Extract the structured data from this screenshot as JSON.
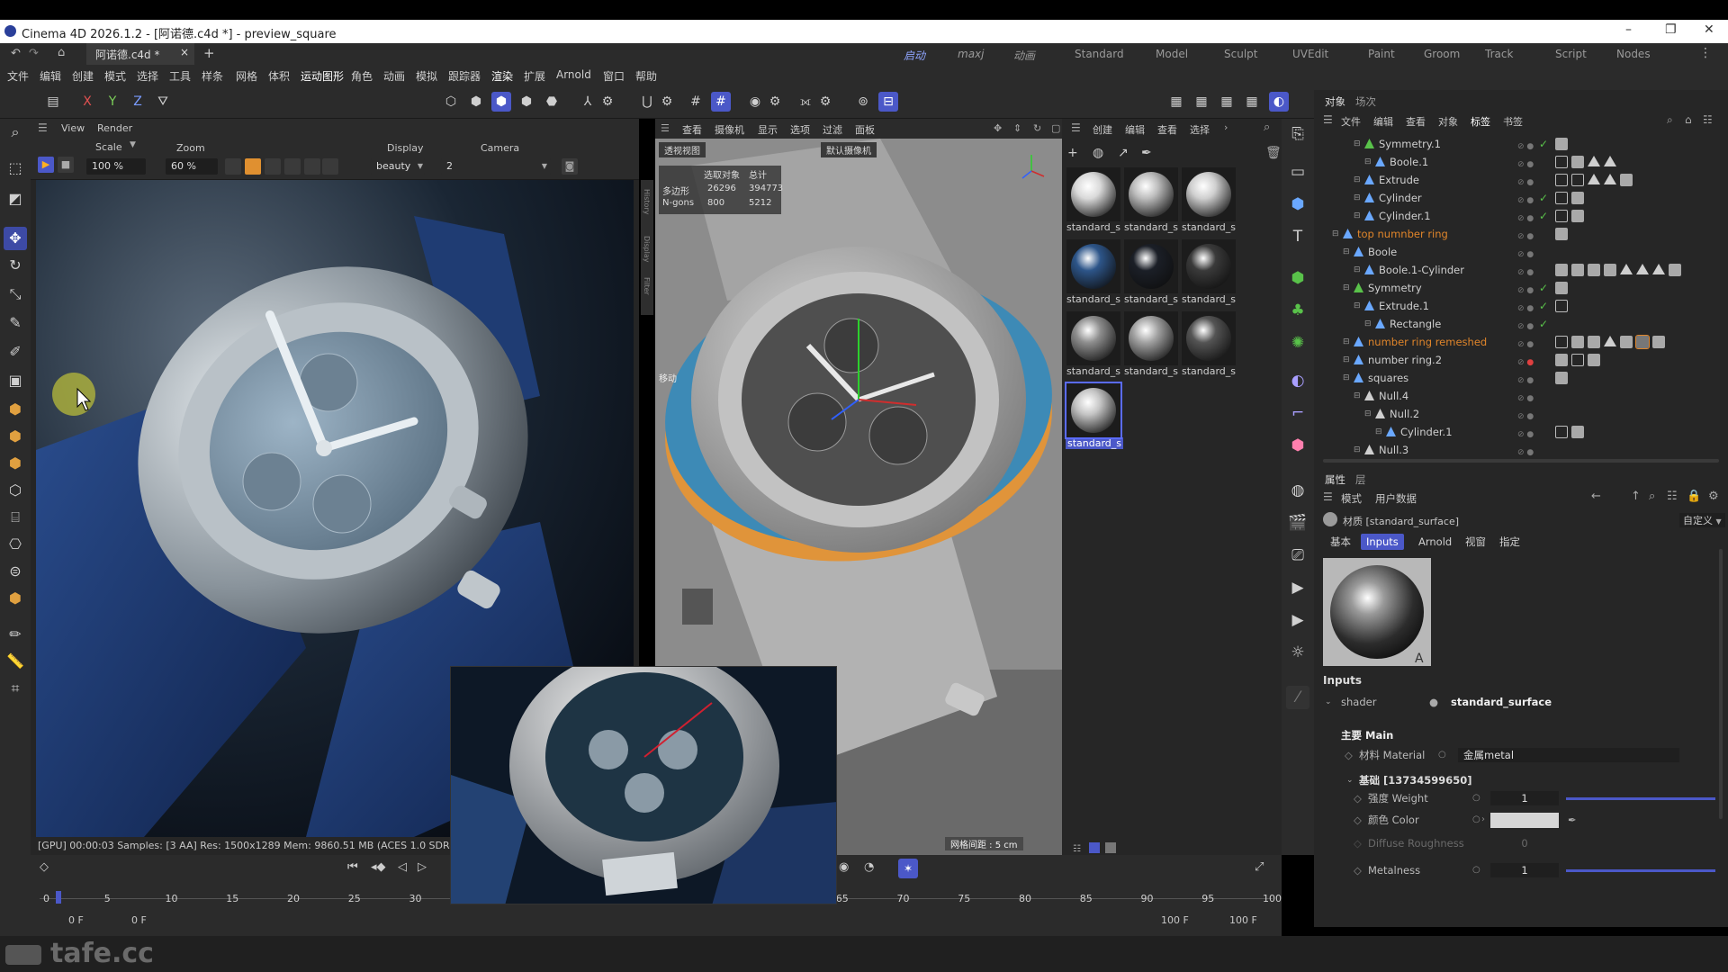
{
  "window": {
    "title": "Cinema 4D 2026.1.2 - [阿诺德.c4d *] - preview_square",
    "minimize": "–",
    "restore": "❐",
    "close": "✕"
  },
  "tabs": {
    "doc_tab": "阿诺德.c4d *",
    "close": "×",
    "add": "+",
    "layouts": [
      "启动",
      "maxj",
      "动画",
      "Standard",
      "Model",
      "Sculpt",
      "UVEdit",
      "Paint",
      "Groom",
      "Track",
      "Script",
      "Nodes"
    ],
    "more": "⋮"
  },
  "menu": [
    "文件",
    "编辑",
    "创建",
    "模式",
    "选择",
    "工具",
    "样条",
    "网格",
    "体积",
    "运动图形",
    "角色",
    "动画",
    "模拟",
    "跟踪器",
    "渲染",
    "扩展",
    "Arnold",
    "窗口",
    "帮助"
  ],
  "axes": {
    "x": "X",
    "y": "Y",
    "z": "Z"
  },
  "picture_viewer": {
    "menu": [
      "View",
      "Render"
    ],
    "scale_label": "Scale",
    "scale_value": "100 %",
    "zoom_label": "Zoom",
    "zoom_value": "60 %",
    "display_label": "Display",
    "display_value": "beauty",
    "camera_label": "Camera",
    "camera_value": "2",
    "status": "[GPU] 00:00:03  Samples: [3 AA]  Res: 1500x1289  Mem: 9860.51 MB  (ACES 1.0 SDR-vi",
    "side_labels": [
      "History",
      "Display",
      "Filter"
    ]
  },
  "viewport": {
    "menu": [
      "查看",
      "摄像机",
      "显示",
      "选项",
      "过滤",
      "面板"
    ],
    "view_name": "透视视图",
    "camera_name": "默认摄像机",
    "stats_header_sel": "选取对象",
    "stats_header_total": "总计",
    "polygons_label": "多边形",
    "polygons_sel": "26296",
    "polygons_total": "394773",
    "ngons_label": "N-gons",
    "ngons_sel": "800",
    "ngons_total": "5212",
    "move_label": "移动",
    "grid_spacing": "网格间距 : 5 cm"
  },
  "material_manager": {
    "menu": [
      "创建",
      "编辑",
      "查看",
      "选择"
    ],
    "materials": [
      {
        "label": "standard_s",
        "color": "#d9d9d9"
      },
      {
        "label": "standard_s",
        "color": "#bdbdbd"
      },
      {
        "label": "standard_s",
        "color": "#cfcfcf"
      },
      {
        "label": "standard_s",
        "color": "#2d5589"
      },
      {
        "label": "standard_s",
        "color": "#1b1f27"
      },
      {
        "label": "standard_s",
        "color": "#3a3a3a"
      },
      {
        "label": "standard_s",
        "color": "#8e8e8e"
      },
      {
        "label": "standard_s",
        "color": "#a2a2a2"
      },
      {
        "label": "standard_s",
        "color": "#545454"
      },
      {
        "label": "standard_s",
        "color": "#c4c4c4"
      }
    ]
  },
  "object_manager": {
    "tabs": [
      "对象",
      "场次"
    ],
    "menu": [
      "文件",
      "编辑",
      "查看",
      "对象",
      "标签",
      "书签"
    ],
    "rows": [
      {
        "name": "Symmetry.1",
        "indent": 3,
        "color": "#cfcfcf",
        "icon": "#59c24a"
      },
      {
        "name": "Boole.1",
        "indent": 4,
        "color": "#cfcfcf",
        "icon": "#6aa8ff"
      },
      {
        "name": "Extrude",
        "indent": 3,
        "color": "#cfcfcf",
        "icon": "#6aa8ff"
      },
      {
        "name": "Cylinder",
        "indent": 3,
        "color": "#cfcfcf",
        "icon": "#6aa8ff"
      },
      {
        "name": "Cylinder.1",
        "indent": 3,
        "color": "#cfcfcf",
        "icon": "#6aa8ff"
      },
      {
        "name": "top numnber ring",
        "indent": 1,
        "color": "#e0852a",
        "icon": "#6aa8ff"
      },
      {
        "name": "Boole",
        "indent": 2,
        "color": "#cfcfcf",
        "icon": "#6aa8ff"
      },
      {
        "name": "Boole.1-Cylinder",
        "indent": 3,
        "color": "#cfcfcf",
        "icon": "#6aa8ff"
      },
      {
        "name": "Symmetry",
        "indent": 2,
        "color": "#cfcfcf",
        "icon": "#59c24a"
      },
      {
        "name": "Extrude.1",
        "indent": 3,
        "color": "#cfcfcf",
        "icon": "#6aa8ff"
      },
      {
        "name": "Rectangle",
        "indent": 4,
        "color": "#cfcfcf",
        "icon": "#6aa8ff"
      },
      {
        "name": "number ring remeshed",
        "indent": 2,
        "color": "#e0852a",
        "icon": "#6aa8ff"
      },
      {
        "name": "number ring.2",
        "indent": 2,
        "color": "#cfcfcf",
        "icon": "#6aa8ff"
      },
      {
        "name": "squares",
        "indent": 2,
        "color": "#cfcfcf",
        "icon": "#6aa8ff"
      },
      {
        "name": "Null.4",
        "indent": 3,
        "color": "#cfcfcf",
        "icon": "#cfcfcf"
      },
      {
        "name": "Null.2",
        "indent": 4,
        "color": "#cfcfcf",
        "icon": "#cfcfcf"
      },
      {
        "name": "Cylinder.1",
        "indent": 5,
        "color": "#cfcfcf",
        "icon": "#6aa8ff"
      },
      {
        "name": "Null.3",
        "indent": 3,
        "color": "#cfcfcf",
        "icon": "#cfcfcf"
      }
    ]
  },
  "attributes": {
    "tabs": [
      "属性",
      "层"
    ],
    "menu": [
      "模式",
      "用户数据"
    ],
    "material_title": "材质 [standard_surface]",
    "preset": "自定义",
    "subtabs": [
      "基本",
      "Inputs",
      "Arnold",
      "视窗",
      "指定"
    ],
    "section": "Inputs",
    "shader_label": "shader",
    "shader_value": "standard_surface",
    "main_header": "主要 Main",
    "material_label": "材料 Material",
    "material_value": "金属metal",
    "base_header": "基础 [13734599650]",
    "weight_label": "强度 Weight",
    "weight_value": "1",
    "color_label": "颜色 Color",
    "color_swatch": "#d6d6d6",
    "diffuse_label": "Diffuse Roughness",
    "diffuse_value": "0",
    "metalness_label": "Metalness",
    "metalness_value": "1"
  },
  "timeline": {
    "ticks": [
      "0",
      "5",
      "10",
      "15",
      "20",
      "25",
      "30",
      "65",
      "70",
      "75",
      "80",
      "85",
      "90",
      "95",
      "100"
    ],
    "start_frame": "0 F",
    "current_frame": "0 F",
    "end_frame": "100 F",
    "max_frame": "100 F"
  },
  "watermark": "tafe.cc",
  "colors": {
    "accent": "#4b58c8",
    "orange": "#e0852a",
    "green": "#59c24a"
  }
}
